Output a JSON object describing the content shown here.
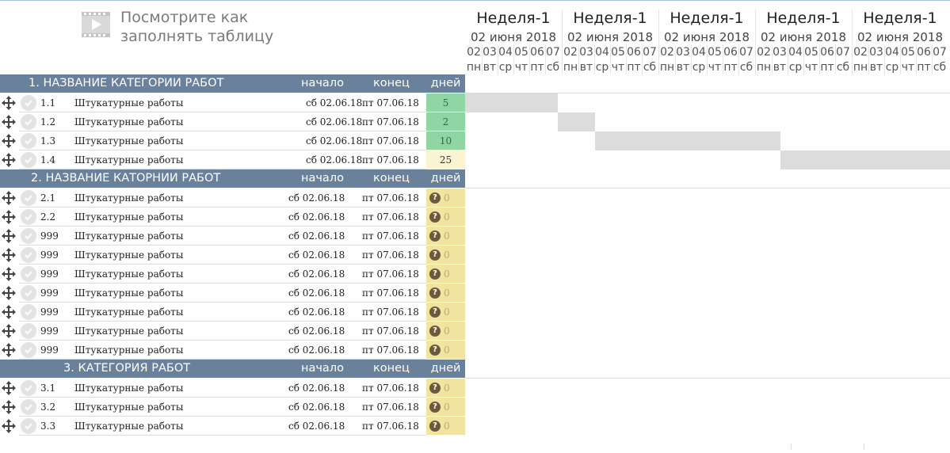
{
  "hint": {
    "line1": "Посмотрите как",
    "line2": "заполнять таблицу",
    "icon": "video-icon"
  },
  "weeks": [
    {
      "title": "Неделя-1",
      "date": "02 июня 2018",
      "days": [
        "02",
        "03",
        "04",
        "05",
        "06",
        "07"
      ],
      "day_names": [
        "пн",
        "вт",
        "ср",
        "чт",
        "пт",
        "сб"
      ]
    },
    {
      "title": "Неделя-1",
      "date": "02 июня 2018",
      "days": [
        "02",
        "03",
        "04",
        "05",
        "06",
        "07"
      ],
      "day_names": [
        "пн",
        "вт",
        "ср",
        "чт",
        "пт",
        "сб"
      ]
    },
    {
      "title": "Неделя-1",
      "date": "02 июня 2018",
      "days": [
        "02",
        "03",
        "04",
        "05",
        "06",
        "07"
      ],
      "day_names": [
        "пн",
        "вт",
        "ср",
        "чт",
        "пт",
        "сб"
      ]
    },
    {
      "title": "Неделя-1",
      "date": "02 июня 2018",
      "days": [
        "02",
        "03",
        "04",
        "05",
        "06",
        "07"
      ],
      "day_names": [
        "пн",
        "вт",
        "ср",
        "чт",
        "пт",
        "сб"
      ]
    },
    {
      "title": "Неделя-1",
      "date": "02 июня 2018",
      "days": [
        "02",
        "03",
        "04",
        "05",
        "06",
        "07"
      ],
      "day_names": [
        "пн",
        "вт",
        "ср",
        "чт",
        "пт",
        "сб"
      ]
    }
  ],
  "columns": {
    "start": "начало",
    "end": "конец",
    "days": "дней"
  },
  "categories": [
    {
      "title": "1. НАЗВАНИЕ КАТЕГОРИИ РАБОТ",
      "rows": [
        {
          "num": "1.1",
          "name": "Штукатурные работы",
          "start": "сб 02.06.18",
          "end": "пт 07.06.18",
          "days": "5",
          "status": "green"
        },
        {
          "num": "1.2",
          "name": "Штукатурные работы",
          "start": "сб 02.06.18",
          "end": "пт 07.06.18",
          "days": "2",
          "status": "green"
        },
        {
          "num": "1.3",
          "name": "Штукатурные работы",
          "start": "сб 02.06.18",
          "end": "пт 07.06.18",
          "days": "10",
          "status": "green"
        },
        {
          "num": "1.4",
          "name": "Штукатурные работы",
          "start": "сб 02.06.18",
          "end": "пт 07.06.18",
          "days": "25",
          "status": "cream"
        }
      ]
    },
    {
      "title": "2. НАЗВАНИЕ КАТОРНИИ РАБОТ",
      "rows": [
        {
          "num": "2.1",
          "name": "Штукатурные работы",
          "start": "сб 02.06.18",
          "end": "пт 07.06.18",
          "days": "0",
          "status": "unknown"
        },
        {
          "num": "2.2",
          "name": "Штукатурные работы",
          "start": "сб 02.06.18",
          "end": "пт 07.06.18",
          "days": "0",
          "status": "unknown"
        },
        {
          "num": "999",
          "name": "Штукатурные работы",
          "start": "сб 02.06.18",
          "end": "пт 07.06.18",
          "days": "0",
          "status": "unknown"
        },
        {
          "num": "999",
          "name": "Штукатурные работы",
          "start": "сб 02.06.18",
          "end": "пт 07.06.18",
          "days": "0",
          "status": "unknown"
        },
        {
          "num": "999",
          "name": "Штукатурные работы",
          "start": "сб 02.06.18",
          "end": "пт 07.06.18",
          "days": "0",
          "status": "unknown"
        },
        {
          "num": "999",
          "name": "Штукатурные работы",
          "start": "сб 02.06.18",
          "end": "пт 07.06.18",
          "days": "0",
          "status": "unknown"
        },
        {
          "num": "999",
          "name": "Штукатурные работы",
          "start": "сб 02.06.18",
          "end": "пт 07.06.18",
          "days": "0",
          "status": "unknown"
        },
        {
          "num": "999",
          "name": "Штукатурные работы",
          "start": "сб 02.06.18",
          "end": "пт 07.06.18",
          "days": "0",
          "status": "unknown"
        },
        {
          "num": "999",
          "name": "Штукатурные работы",
          "start": "сб 02.06.18",
          "end": "пт 07.06.18",
          "days": "0",
          "status": "unknown"
        }
      ]
    },
    {
      "title": "3. КАТЕГОРИЯ РАБОТ",
      "rows": [
        {
          "num": "3.1",
          "name": "Штукатурные работы",
          "start": "сб 02.06.18",
          "end": "пт 07.06.18",
          "days": "0",
          "status": "unknown"
        },
        {
          "num": "3.2",
          "name": "Штукатурные работы",
          "start": "сб 02.06.18",
          "end": "пт 07.06.18",
          "days": "0",
          "status": "unknown"
        },
        {
          "num": "3.3",
          "name": "Штукатурные работы",
          "start": "сб 02.06.18",
          "end": "пт 07.06.18",
          "days": "0",
          "status": "unknown"
        }
      ]
    }
  ],
  "colors": {
    "header": "#6a819c",
    "green": "#8fd6a4",
    "cream": "#faf4d3",
    "yellow": "#f1e3a0",
    "bar": "#dcdcdc"
  },
  "icons": [
    "move-icon",
    "check-icon",
    "question-icon",
    "video-icon"
  ]
}
